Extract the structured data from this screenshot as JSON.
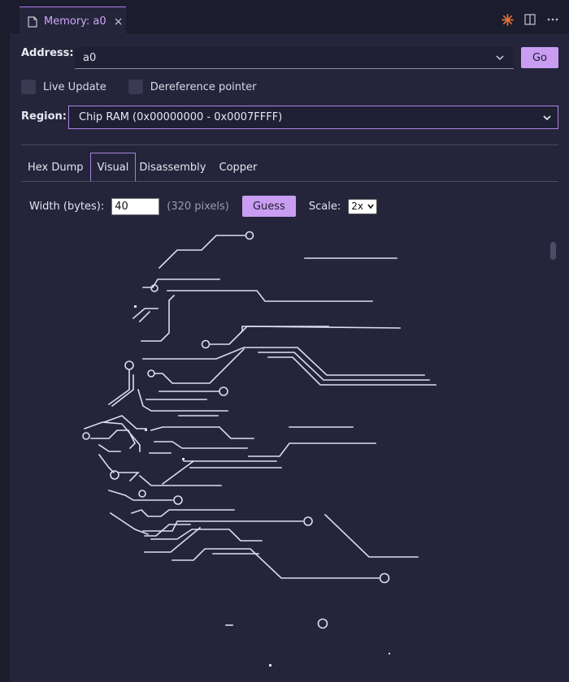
{
  "tab": {
    "label": "Memory: a0",
    "close": "×"
  },
  "address": {
    "label": "Address:",
    "value": "a0",
    "go_label": "Go"
  },
  "options": {
    "live_update": "Live Update",
    "dereference": "Dereference pointer"
  },
  "region": {
    "label": "Region:",
    "value": "Chip RAM (0x00000000 - 0x0007FFFF)"
  },
  "view_tabs": [
    "Hex Dump",
    "Visual",
    "Disassembly",
    "Copper"
  ],
  "active_view_tab": "Visual",
  "visual": {
    "width_label": "Width (bytes):",
    "width_value": "40",
    "pixels_note": "(320 pixels)",
    "guess_label": "Guess",
    "scale_label": "Scale:",
    "scale_value": "2x"
  },
  "colors": {
    "accent": "#c99ef2",
    "trace": "#dcdcf5",
    "background": "#24253a"
  },
  "icons": [
    "file-icon",
    "close-icon",
    "claude-icon",
    "split-editor-icon",
    "more-icon",
    "chevron-down-icon"
  ]
}
